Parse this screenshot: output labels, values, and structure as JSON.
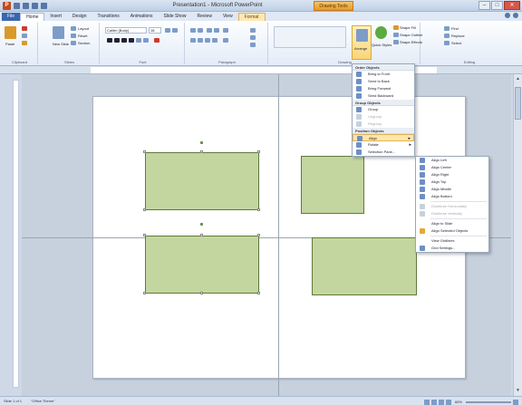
{
  "titlebar": {
    "app_letter": "P",
    "title": "Presentation1 - Microsoft PowerPoint",
    "contextual_tab": "Drawing Tools",
    "minimize": "–",
    "maximize": "□",
    "close": "✕"
  },
  "tabs": [
    "File",
    "Home",
    "Insert",
    "Design",
    "Transitions",
    "Animations",
    "Slide Show",
    "Review",
    "View",
    "Format"
  ],
  "ribbon": {
    "paste_label": "Paste",
    "cut_label": "Cut",
    "copy_label": "Copy",
    "format_painter_label": "Format Painter",
    "clipboard_group": "Clipboard",
    "new_slide_label": "New Slide",
    "layout_label": "Layout",
    "reset_label": "Reset",
    "section_label": "Section",
    "slides_group": "Slides",
    "font_name": "Calibri (Body)",
    "font_size": "18",
    "font_group": "Font",
    "paragraph_group": "Paragraph",
    "drawing_group": "Drawing",
    "arrange_label": "Arrange",
    "quick_styles_label": "Quick Styles",
    "shape_fill_label": "Shape Fill",
    "shape_outline_label": "Shape Outline",
    "shape_effects_label": "Shape Effects",
    "find_label": "Find",
    "replace_label": "Replace",
    "select_label": "Select",
    "editing_group": "Editing"
  },
  "arrange_menu": {
    "header_order": "Order Objects",
    "bring_to_front": "Bring to Front",
    "send_to_back": "Send to Back",
    "bring_forward": "Bring Forward",
    "send_backward": "Send Backward",
    "header_group": "Group Objects",
    "group": "Group",
    "ungroup": "Ungroup",
    "regroup": "Regroup",
    "header_position": "Position Objects",
    "align": "Align",
    "rotate": "Rotate",
    "selection_pane": "Selection Pane..."
  },
  "align_menu": {
    "align_left": "Align Left",
    "align_center": "Align Center",
    "align_right": "Align Right",
    "align_top": "Align Top",
    "align_middle": "Align Middle",
    "align_bottom": "Align Bottom",
    "distribute_horizontally": "Distribute Horizontally",
    "distribute_vertically": "Distribute Vertically",
    "align_to_slide": "Align to Slide",
    "align_selected": "Align Selected Objects",
    "view_gridlines": "View Gridlines",
    "grid_settings": "Grid Settings..."
  },
  "statusbar": {
    "slide_info": "Slide 1 of 1",
    "theme": "\"Office Theme\"",
    "zoom": "66%"
  }
}
